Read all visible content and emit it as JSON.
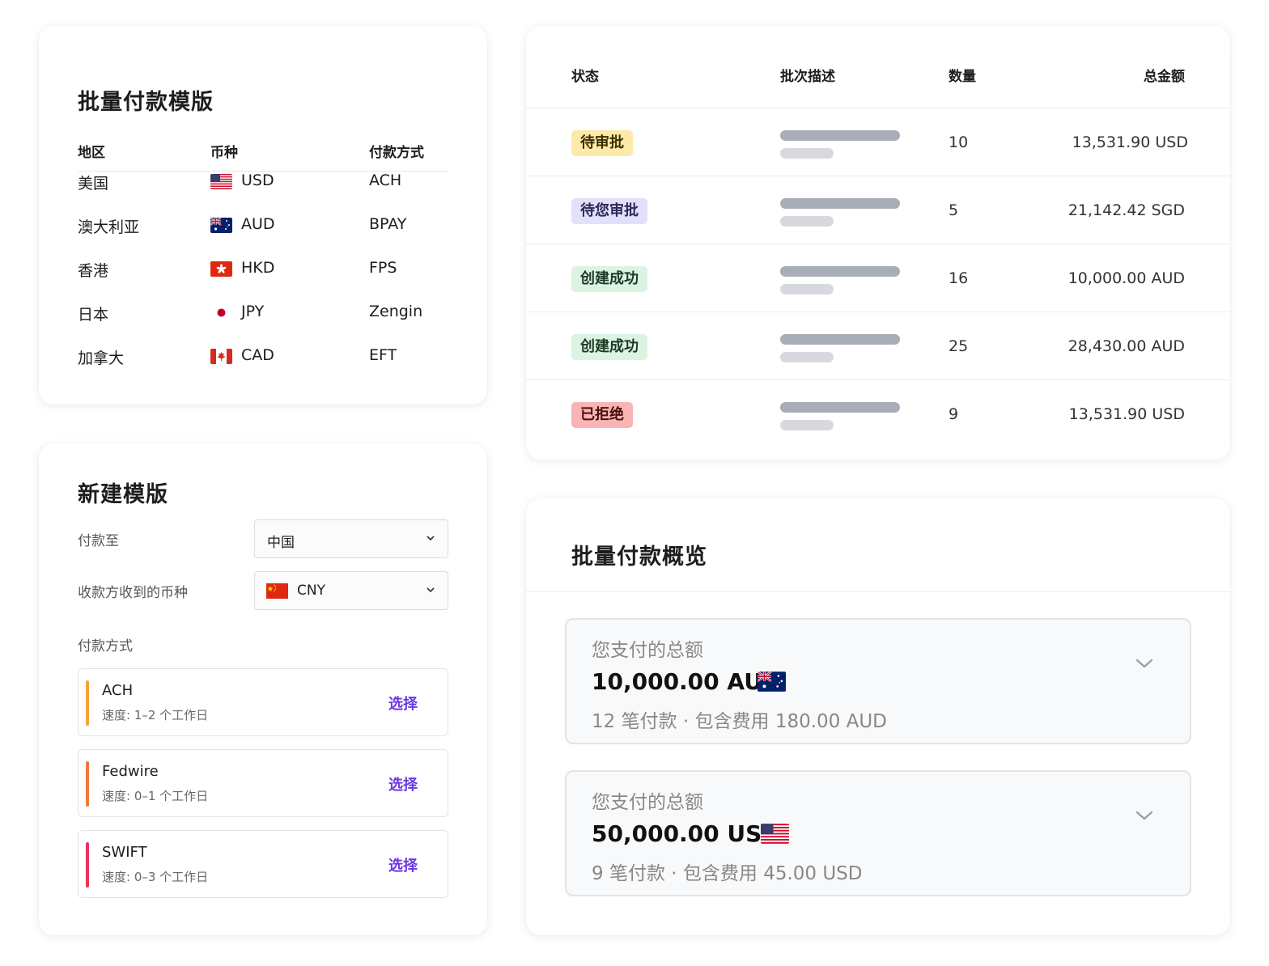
{
  "template_card": {
    "title": "批量付款模版",
    "headers": {
      "region": "地区",
      "currency": "币种",
      "method": "付款方式"
    },
    "rows": [
      {
        "region": "美国",
        "flag": "us-flag-icon",
        "currency": "USD",
        "method": "ACH"
      },
      {
        "region": "澳大利亚",
        "flag": "au-flag-icon",
        "currency": "AUD",
        "method": "BPAY"
      },
      {
        "region": "香港",
        "flag": "hk-flag-icon",
        "currency": "HKD",
        "method": "FPS"
      },
      {
        "region": "日本",
        "flag": "jp-flag-icon",
        "currency": "JPY",
        "method": "Zengin"
      },
      {
        "region": "加拿大",
        "flag": "ca-flag-icon",
        "currency": "CAD",
        "method": "EFT"
      }
    ]
  },
  "new_template": {
    "title": "新建模版",
    "pay_to_label": "付款至",
    "pay_to_value": "中国",
    "currency_label": "收款方收到的币种",
    "currency_value": "CNY",
    "currency_flag": "cn-flag-icon",
    "methods_label": "付款方式",
    "methods": [
      {
        "name": "ACH",
        "speed": "速度: 1–2 个工作日",
        "select": "选择",
        "accent": "#f5a33c"
      },
      {
        "name": "Fedwire",
        "speed": "速度: 0–1 个工作日",
        "select": "选择",
        "accent": "#f07a3c"
      },
      {
        "name": "SWIFT",
        "speed": "速度: 0–3 个工作日",
        "select": "选择",
        "accent": "#e8345d"
      }
    ]
  },
  "batches": {
    "headers": {
      "status": "状态",
      "description": "批次描述",
      "count": "数量",
      "total": "总金额"
    },
    "rows": [
      {
        "status": "待审批",
        "status_bg": "#fde9a8",
        "status_color": "#3a2f00",
        "count": "10",
        "total": "13,531.90 USD"
      },
      {
        "status": "待您审批",
        "status_bg": "#e3e0fb",
        "status_color": "#2c2a55",
        "count": "5",
        "total": "21,142.42 SGD"
      },
      {
        "status": "创建成功",
        "status_bg": "#dcf3e2",
        "status_color": "#1d3a26",
        "count": "16",
        "total": "10,000.00 AUD"
      },
      {
        "status": "创建成功",
        "status_bg": "#dcf3e2",
        "status_color": "#1d3a26",
        "count": "25",
        "total": "28,430.00 AUD"
      },
      {
        "status": "已拒绝",
        "status_bg": "#f9b4b4",
        "status_color": "#4a0f0f",
        "count": "9",
        "total": "13,531.90 USD"
      }
    ]
  },
  "overview": {
    "title": "批量付款概览",
    "totals": [
      {
        "label": "您支付的总额",
        "amount": "10,000.00 AUD",
        "flag": "au-flag-icon",
        "sub": "12 笔付款 · 包含费用 180.00 AUD"
      },
      {
        "label": "您支付的总额",
        "amount": "50,000.00 USD",
        "flag": "us-flag-icon",
        "sub": "9 笔付款 · 包含费用 45.00 USD"
      }
    ]
  }
}
